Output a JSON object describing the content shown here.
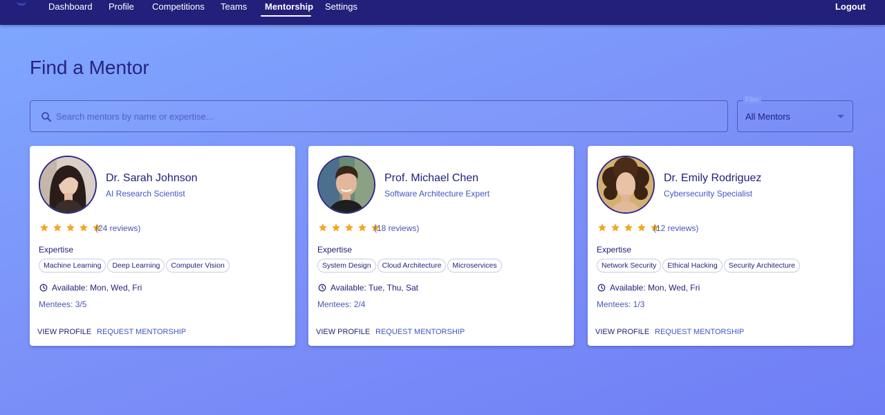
{
  "nav": {
    "items": [
      {
        "label": "Dashboard",
        "active": false
      },
      {
        "label": "Profile",
        "active": false
      },
      {
        "label": "Competitions",
        "active": false
      },
      {
        "label": "Teams",
        "active": false
      },
      {
        "label": "Mentorship",
        "active": true
      },
      {
        "label": "Settings",
        "active": false
      }
    ],
    "logout_label": "Logout"
  },
  "page": {
    "title": "Find a Mentor"
  },
  "search": {
    "placeholder": "Search mentors by name or expertise...",
    "value": ""
  },
  "filter": {
    "label": "Filter",
    "value": "All Mentors"
  },
  "mentors": [
    {
      "name": "Dr. Sarah Johnson",
      "title": "AI Research Scientist",
      "rating": 5,
      "reviews": "(24 reviews)",
      "expertise_label": "Expertise",
      "expertise": [
        "Machine Learning",
        "Deep Learning",
        "Computer Vision"
      ],
      "availability": "Available: Mon, Wed, Fri",
      "mentees": "Mentees: 3/5",
      "view_label": "View Profile",
      "request_label": "Request Mentorship"
    },
    {
      "name": "Prof. Michael Chen",
      "title": "Software Architecture Expert",
      "rating": 5,
      "reviews": "(18 reviews)",
      "expertise_label": "Expertise",
      "expertise": [
        "System Design",
        "Cloud Architecture",
        "Microservices"
      ],
      "availability": "Available: Tue, Thu, Sat",
      "mentees": "Mentees: 2/4",
      "view_label": "View Profile",
      "request_label": "Request Mentorship"
    },
    {
      "name": "Dr. Emily Rodriguez",
      "title": "Cybersecurity Specialist",
      "rating": 5,
      "reviews": "(12 reviews)",
      "expertise_label": "Expertise",
      "expertise": [
        "Network Security",
        "Ethical Hacking",
        "Security Architecture"
      ],
      "availability": "Available: Mon, Wed, Fri",
      "mentees": "Mentees: 1/3",
      "view_label": "View Profile",
      "request_label": "Request Mentorship"
    }
  ],
  "icons": {
    "search": "search-icon",
    "star": "star-icon",
    "clock": "clock-icon",
    "caret": "chevron-down-icon"
  },
  "colors": {
    "nav_bg": "#22207a",
    "accent": "#3e53c6",
    "star": "#f5a623",
    "text_dark": "#22207a"
  }
}
